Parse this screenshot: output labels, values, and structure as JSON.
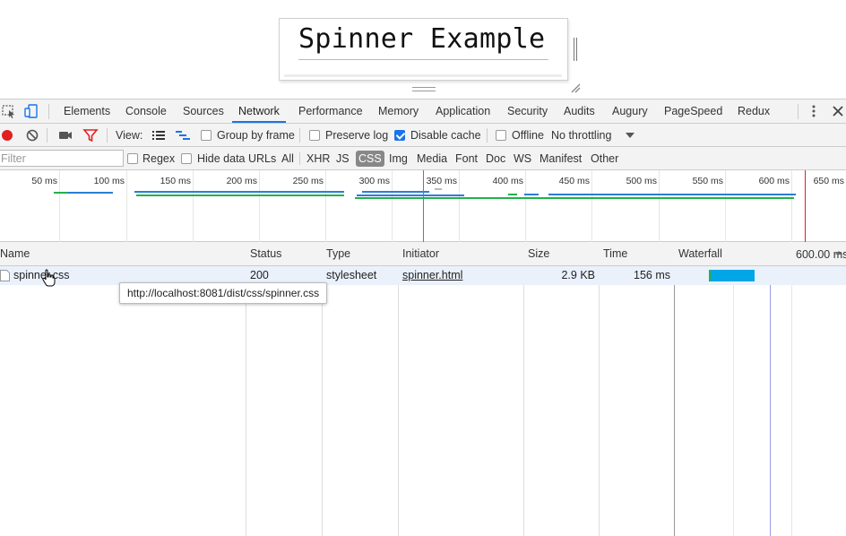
{
  "page": {
    "heading": "Spinner Example"
  },
  "devtools": {
    "tabs": [
      {
        "label": "Elements"
      },
      {
        "label": "Console"
      },
      {
        "label": "Sources"
      },
      {
        "label": "Network",
        "active": true
      },
      {
        "label": "Performance"
      },
      {
        "label": "Memory"
      },
      {
        "label": "Application"
      },
      {
        "label": "Security"
      },
      {
        "label": "Audits"
      },
      {
        "label": "Augury"
      },
      {
        "label": "PageSpeed"
      },
      {
        "label": "Redux"
      }
    ],
    "toolbar": {
      "view_label": "View:",
      "group_by_frame": {
        "label": "Group by frame",
        "checked": false
      },
      "preserve_log": {
        "label": "Preserve log",
        "checked": false
      },
      "disable_cache": {
        "label": "Disable cache",
        "checked": true
      },
      "offline": {
        "label": "Offline",
        "checked": false
      },
      "throttling": "No throttling"
    },
    "filterbar": {
      "placeholder": "Filter",
      "regex": {
        "label": "Regex",
        "checked": false
      },
      "hide_data_urls": {
        "label": "Hide data URLs",
        "checked": false
      },
      "types": [
        "All",
        "XHR",
        "JS",
        "CSS",
        "Img",
        "Media",
        "Font",
        "Doc",
        "WS",
        "Manifest",
        "Other"
      ],
      "active_type": "CSS"
    },
    "overview": {
      "ticks": [
        "50 ms",
        "100 ms",
        "150 ms",
        "200 ms",
        "250 ms",
        "300 ms",
        "350 ms",
        "400 ms",
        "450 ms",
        "500 ms",
        "550 ms",
        "600 ms",
        "650 ms"
      ]
    },
    "table": {
      "columns": [
        "Name",
        "Status",
        "Type",
        "Initiator",
        "Size",
        "Time",
        "Waterfall"
      ],
      "waterfall_tick": "600.00 ms",
      "rows": [
        {
          "name": "spinner.css",
          "status": "200",
          "type": "stylesheet",
          "initiator": "spinner.html",
          "size": "2.9 KB",
          "time": "156 ms"
        }
      ],
      "tooltip": "http://localhost:8081/dist/css/spinner.css"
    },
    "colors": {
      "accent": "#1a73e8",
      "record": "#e02020",
      "waterfall_bar": "#00a6e6",
      "green_line": "#22b14c",
      "blue_line": "#2a7fd4"
    }
  }
}
